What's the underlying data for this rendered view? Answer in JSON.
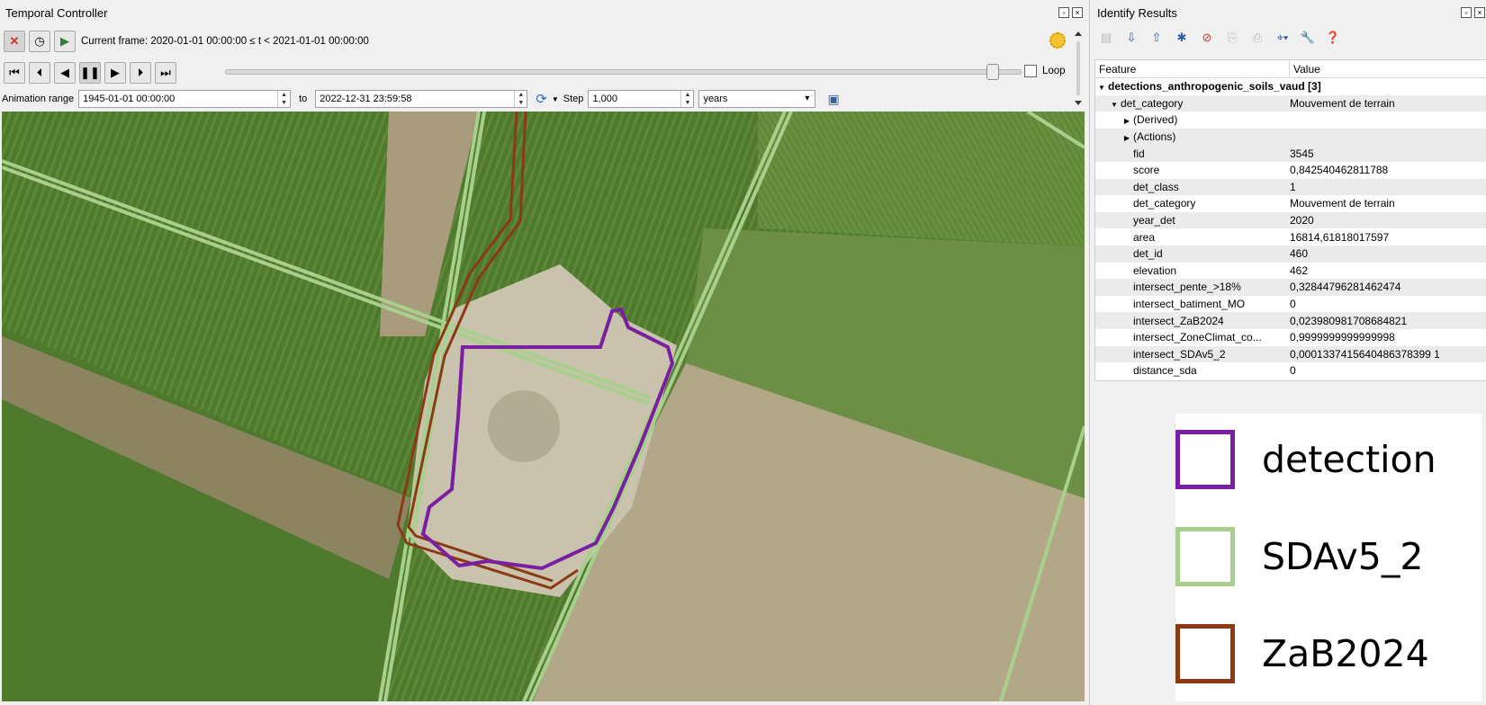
{
  "temporal_controller": {
    "title": "Temporal Controller",
    "current_frame": "Current frame: 2020-01-01 00:00:00 ≤ t < 2021-01-01 00:00:00",
    "loop_label": "Loop",
    "animation_range_label": "Animation range",
    "range_start": "1945-01-01 00:00:00",
    "to_label": "to",
    "range_end": "2022-12-31 23:59:58",
    "step_label": "Step",
    "step_value": "1,000",
    "step_unit": "years",
    "slider_fraction": 0.96
  },
  "identify_results": {
    "title": "Identify Results",
    "col_feature": "Feature",
    "col_value": "Value",
    "layer_name": "detections_anthropogenic_soils_vaud  [3]",
    "top_attr": {
      "name": "det_category",
      "value": "Mouvement de terrain"
    },
    "derived_label": "(Derived)",
    "actions_label": "(Actions)",
    "attributes": [
      {
        "name": "fid",
        "value": "3545"
      },
      {
        "name": "score",
        "value": "0,842540462811788"
      },
      {
        "name": "det_class",
        "value": "1"
      },
      {
        "name": "det_category",
        "value": "Mouvement de terrain"
      },
      {
        "name": "year_det",
        "value": "2020"
      },
      {
        "name": "area",
        "value": "16814,61818017597"
      },
      {
        "name": "det_id",
        "value": "460"
      },
      {
        "name": "elevation",
        "value": "462"
      },
      {
        "name": "intersect_pente_>18%",
        "value": "0,32844796281462474"
      },
      {
        "name": "intersect_batiment_MO",
        "value": "0"
      },
      {
        "name": "intersect_ZaB2024",
        "value": "0,023980981708684821"
      },
      {
        "name": "intersect_ZoneClimat_co...",
        "value": "0,9999999999999998"
      },
      {
        "name": "intersect_SDAv5_2",
        "value": "0,0001337415640486378399 1"
      },
      {
        "name": "distance_sda",
        "value": "0"
      }
    ]
  },
  "legend": {
    "items": [
      {
        "label": "detection",
        "color": "#7b1fa2"
      },
      {
        "label": "SDAv5_2",
        "color": "#a8d08d"
      },
      {
        "label": "ZaB2024",
        "color": "#8b3a14"
      }
    ]
  },
  "icons": [
    "stop-icon",
    "clock-icon",
    "play-animation-icon",
    "first-frame-icon",
    "previous-frame-icon",
    "rewind-icon",
    "pause-icon",
    "play-icon",
    "next-frame-icon",
    "last-frame-icon",
    "refresh-icon",
    "save-icon",
    "settings-icon"
  ]
}
